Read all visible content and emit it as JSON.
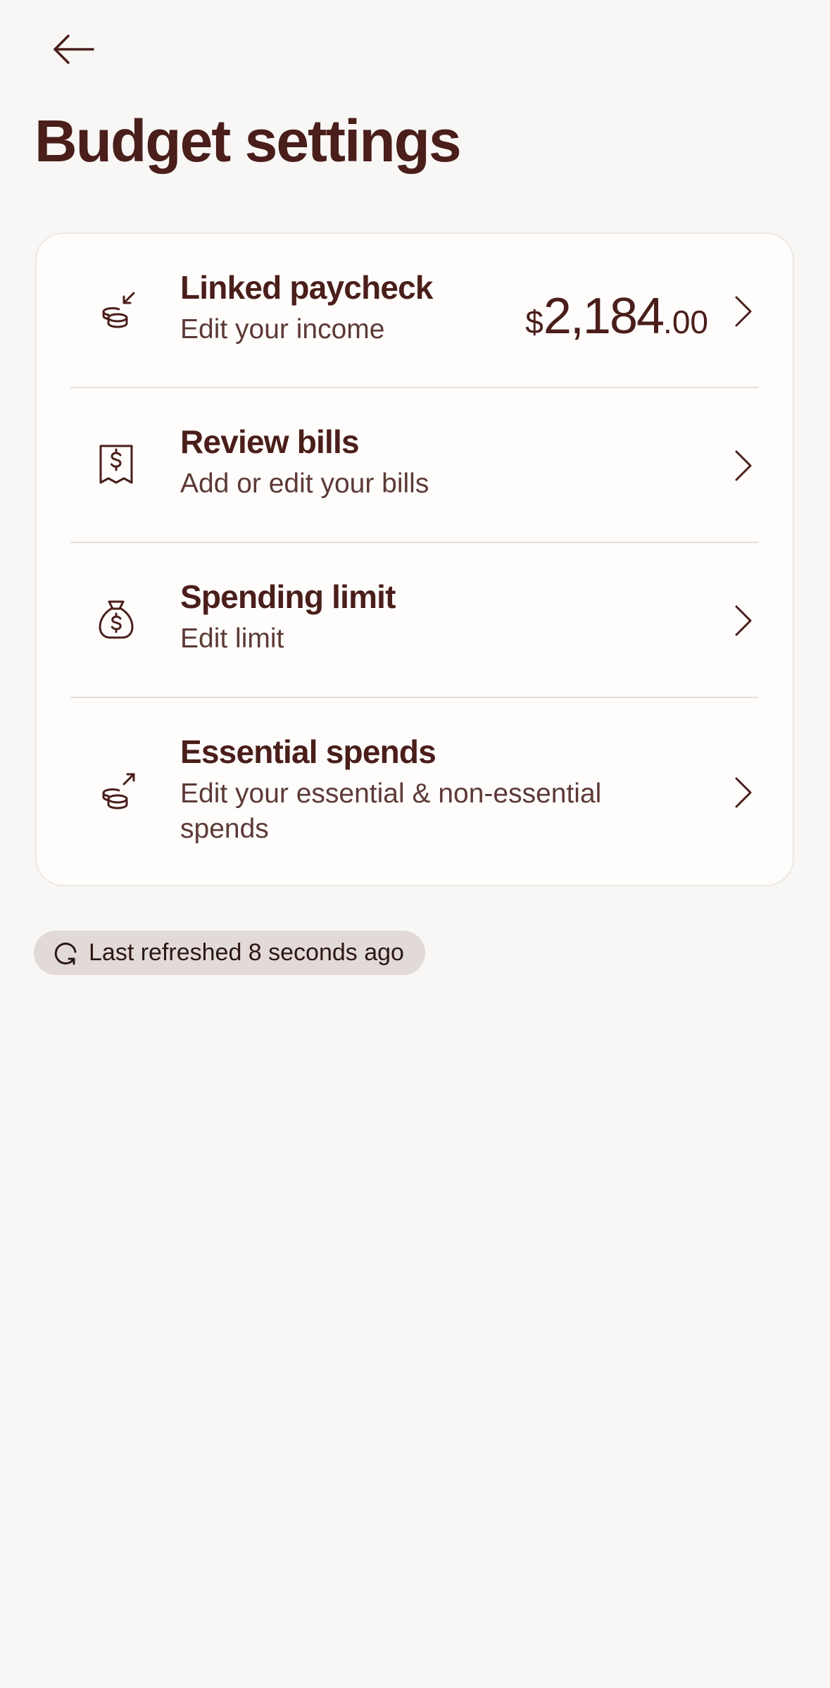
{
  "header": {
    "back_icon": "arrow-left-icon",
    "title": "Budget settings"
  },
  "settings": {
    "items": [
      {
        "icon": "coins-arrow-in-icon",
        "title": "Linked paycheck",
        "subtitle": "Edit your income",
        "amount": {
          "currency": "$",
          "whole": "2,184",
          "decimal": ".00"
        }
      },
      {
        "icon": "receipt-dollar-icon",
        "title": "Review bills",
        "subtitle": "Add or edit your bills"
      },
      {
        "icon": "money-bag-icon",
        "title": "Spending limit",
        "subtitle": "Edit limit"
      },
      {
        "icon": "coins-arrow-out-icon",
        "title": "Essential spends",
        "subtitle": "Edit your essential & non-essential spends"
      }
    ]
  },
  "status": {
    "refresh_icon": "refresh-icon",
    "text": "Last refreshed 8 seconds ago"
  },
  "colors": {
    "background": "#f8f7f5",
    "card": "#fefdfc",
    "primary_text": "#4a1e1a",
    "pill_background": "#e2dad7"
  }
}
